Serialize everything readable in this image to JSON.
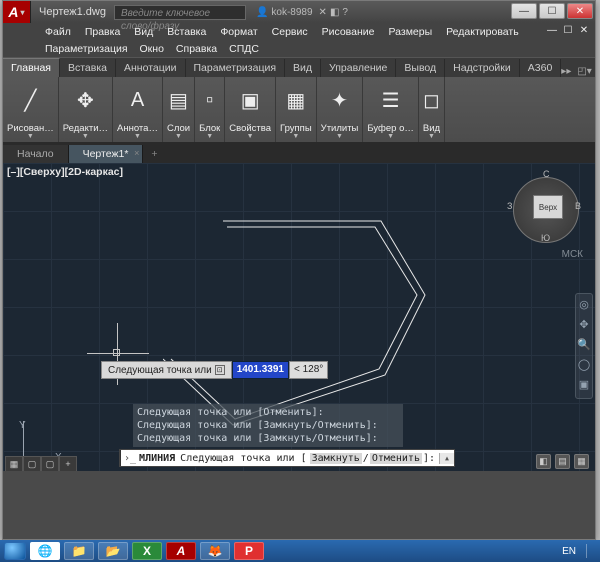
{
  "titlebar": {
    "doc_name": "Чертеж1.dwg",
    "search_placeholder": "Введите ключевое слово/фразу",
    "user": "kok-8989",
    "help_icons": [
      "✕",
      "✕",
      "▾"
    ]
  },
  "menu": {
    "row1": [
      "Файл",
      "Правка",
      "Вид",
      "Вставка",
      "Формат",
      "Сервис",
      "Рисование",
      "Размеры",
      "Редактировать"
    ],
    "row2": [
      "Параметризация",
      "Окно",
      "Справка",
      "СПДС"
    ]
  },
  "ribbon_tabs": [
    "Главная",
    "Вставка",
    "Аннотации",
    "Параметризация",
    "Вид",
    "Управление",
    "Вывод",
    "Надстройки",
    "A360"
  ],
  "ribbon_tabs_active": 0,
  "ribbon_panels": [
    {
      "icon": "╱",
      "label": "Рисован…"
    },
    {
      "icon": "✥",
      "label": "Редакти…"
    },
    {
      "icon": "A",
      "label": "Аннота…"
    },
    {
      "icon": "▤",
      "label": "Слои"
    },
    {
      "icon": "▫",
      "label": "Блок"
    },
    {
      "icon": "▣",
      "label": "Свойства"
    },
    {
      "icon": "▦",
      "label": "Группы"
    },
    {
      "icon": "✦",
      "label": "Утилиты"
    },
    {
      "icon": "☰",
      "label": "Буфер о…"
    },
    {
      "icon": "◻",
      "label": "Вид"
    }
  ],
  "file_tabs": [
    {
      "label": "Начало",
      "active": false
    },
    {
      "label": "Чертеж1*",
      "active": true
    }
  ],
  "canvas": {
    "view_label": "[–][Сверху][2D-каркас]",
    "viewcube": {
      "face": "Верх",
      "n": "С",
      "s": "Ю",
      "e": "В",
      "w": "З"
    },
    "wcs_label": "МСК",
    "ucs": {
      "x": "X",
      "y": "Y"
    },
    "dynamic_input": {
      "prompt": "Следующая точка или",
      "distance": "1401.3391",
      "angle": "< 128°"
    },
    "cmd_history": [
      "Следующая точка или [Отменить]:",
      "Следующая точка или [Замкнуть/Отменить]:",
      "Следующая точка или [Замкнуть/Отменить]:"
    ],
    "cmd_line": {
      "cmd": "МЛИНИЯ",
      "prompt": "Следующая точка или [",
      "opts": [
        "Замкнуть",
        "Отменить"
      ],
      "suffix": "]:"
    }
  },
  "taskbar": {
    "lang": "EN",
    "apps": [
      "◉",
      "📁",
      "📂",
      "X",
      "A",
      "🦊",
      "P"
    ]
  }
}
